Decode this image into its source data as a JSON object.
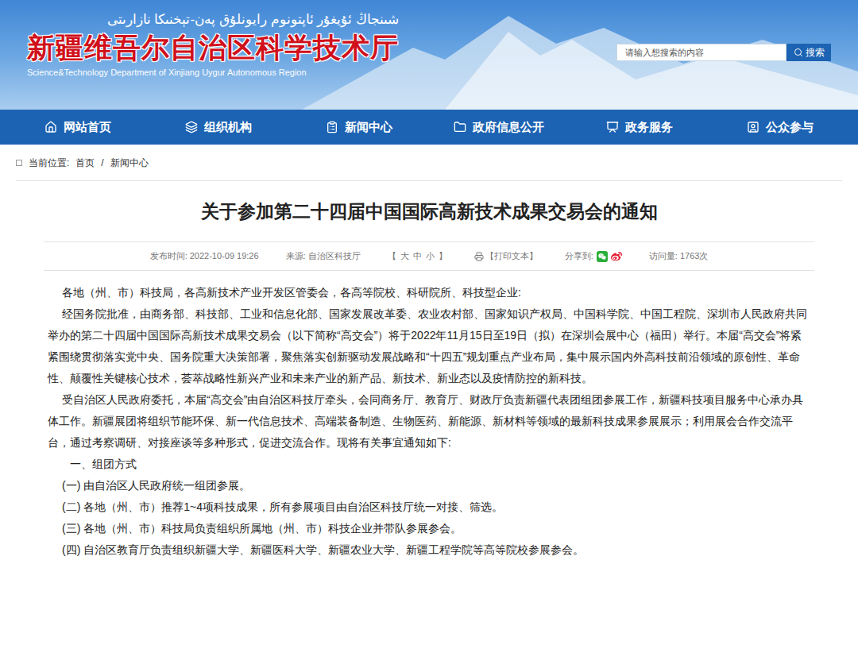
{
  "header": {
    "uyghur_title": "شىنجاڭ ئۇيغۇر ئاپتونوم رايونلۇق پەن-تېخنىكا نازارىتى",
    "title": "新疆维吾尔自治区科学技术厅",
    "subtitle": "Science&Technology Department of Xinjiang Uygur Autonomous Region",
    "search": {
      "placeholder": "请输入想搜索的内容",
      "button": "搜索"
    }
  },
  "nav": [
    {
      "label": "网站首页",
      "icon": "home"
    },
    {
      "label": "组织机构",
      "icon": "layers"
    },
    {
      "label": "新闻中心",
      "icon": "news"
    },
    {
      "label": "政府信息公开",
      "icon": "folder"
    },
    {
      "label": "政务服务",
      "icon": "service"
    },
    {
      "label": "公众参与",
      "icon": "people"
    }
  ],
  "breadcrumb": {
    "label": "当前位置:",
    "items": [
      "首页",
      "新闻中心"
    ],
    "separator": "/"
  },
  "article": {
    "title": "关于参加第二十四届中国国际高新技术成果交易会的通知",
    "meta": {
      "published": "发布时间: 2022-10-09 19:26",
      "source": "来源: 自治区科技厅",
      "font_size": {
        "open": "【",
        "options": [
          "大",
          "中",
          "小"
        ],
        "close": "】"
      },
      "print": "【打印文本】",
      "share": "分享到:",
      "views": "访问量: 1763次"
    },
    "paragraphs": [
      {
        "kind": "salutation",
        "text": "各地（州、市）科技局，各高新技术产业开发区管委会，各高等院校、科研院所、科技型企业:"
      },
      {
        "kind": "paragraph",
        "text": "经国务院批准，由商务部、科技部、工业和信息化部、国家发展改革委、农业农村部、国家知识产权局、中国科学院、中国工程院、深圳市人民政府共同举办的第二十四届中国国际高新技术成果交易会（以下简称“高交会”）将于2022年11月15日至19日（拟）在深圳会展中心（福田）举行。本届“高交会”将紧紧围绕贯彻落实党中央、国务院重大决策部署，聚焦落实创新驱动发展战略和“十四五”规划重点产业布局，集中展示国内外高科技前沿领域的原创性、革命性、颠覆性关键核心技术，荟萃战略性新兴产业和未来产业的新产品、新技术、新业态以及疫情防控的新科技。"
      },
      {
        "kind": "paragraph",
        "text": "受自治区人民政府委托，本届“高交会”由自治区科技厅牵头，会同商务厅、教育厅、财政厅负责新疆代表团组团参展工作，新疆科技项目服务中心承办具体工作。新疆展团将组织节能环保、新一代信息技术、高端装备制造、生物医药、新能源、新材料等领域的最新科技成果参展展示；利用展会合作交流平台，通过考察调研、对接座谈等多种形式，促进交流合作。现将有关事宜通知如下:"
      },
      {
        "kind": "heading",
        "text": "一、组团方式"
      },
      {
        "kind": "item",
        "text": "(一) 由自治区人民政府统一组团参展。"
      },
      {
        "kind": "item",
        "text": "(二) 各地（州、市）推荐1~4项科技成果，所有参展项目由自治区科技厅统一对接、筛选。"
      },
      {
        "kind": "item",
        "text": "(三) 各地（州、市）科技局负责组织所属地（州、市）科技企业并带队参展参会。"
      },
      {
        "kind": "item",
        "text": "(四) 自治区教育厅负责组织新疆大学、新疆医科大学、新疆农业大学、新疆工程学院等高等院校参展参会。"
      }
    ]
  }
}
